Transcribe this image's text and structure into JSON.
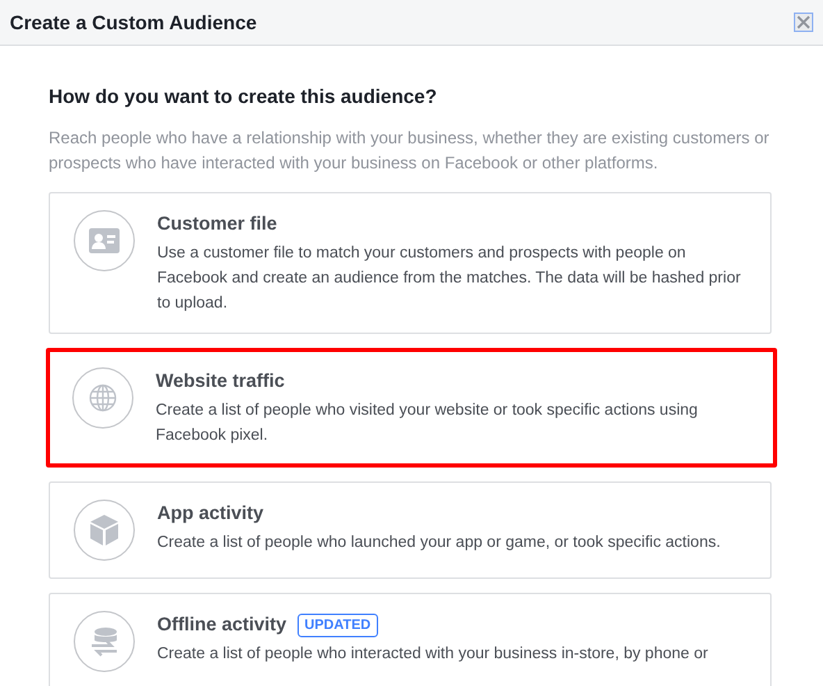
{
  "window": {
    "title": "Create a Custom Audience"
  },
  "heading": "How do you want to create this audience?",
  "intro": "Reach people who have a relationship with your business, whether they are existing customers or prospects who have interacted with your business on Facebook or other platforms.",
  "options": [
    {
      "kind": "customer-file",
      "title": "Customer file",
      "description": "Use a customer file to match your customers and prospects with people on Facebook and create an audience from the matches. The data will be hashed prior to upload.",
      "highlighted": false
    },
    {
      "kind": "website",
      "title": "Website traffic",
      "description": "Create a list of people who visited your website or took specific actions using Facebook pixel.",
      "highlighted": true
    },
    {
      "kind": "app",
      "title": "App activity",
      "description": "Create a list of people who launched your app or game, or took specific actions.",
      "highlighted": false
    },
    {
      "kind": "offline",
      "title": "Offline activity",
      "badge": "UPDATED",
      "description": "Create a list of people who interacted with your business in-store, by phone or",
      "highlighted": false
    }
  ]
}
